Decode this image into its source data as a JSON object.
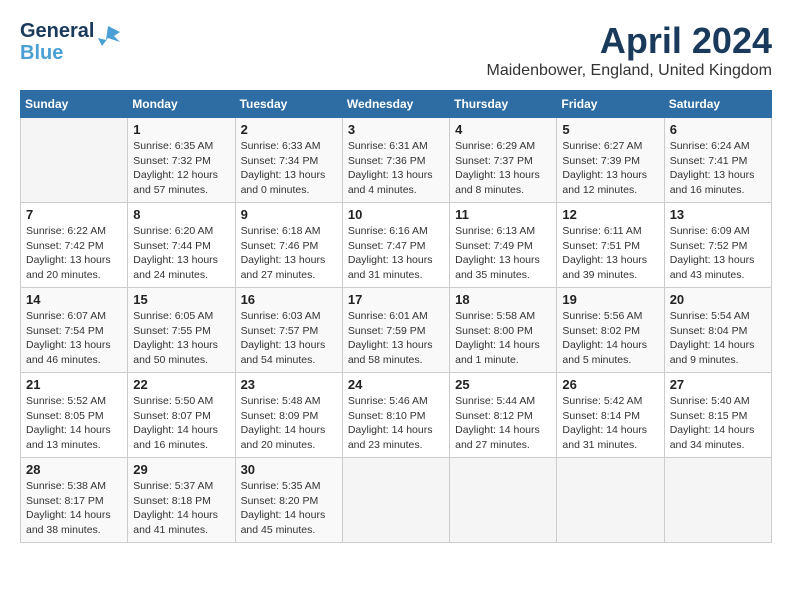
{
  "header": {
    "logo_general": "General",
    "logo_blue": "Blue",
    "month": "April 2024",
    "location": "Maidenbower, England, United Kingdom"
  },
  "weekdays": [
    "Sunday",
    "Monday",
    "Tuesday",
    "Wednesday",
    "Thursday",
    "Friday",
    "Saturday"
  ],
  "weeks": [
    [
      {
        "day": "",
        "info": ""
      },
      {
        "day": "1",
        "info": "Sunrise: 6:35 AM\nSunset: 7:32 PM\nDaylight: 12 hours\nand 57 minutes."
      },
      {
        "day": "2",
        "info": "Sunrise: 6:33 AM\nSunset: 7:34 PM\nDaylight: 13 hours\nand 0 minutes."
      },
      {
        "day": "3",
        "info": "Sunrise: 6:31 AM\nSunset: 7:36 PM\nDaylight: 13 hours\nand 4 minutes."
      },
      {
        "day": "4",
        "info": "Sunrise: 6:29 AM\nSunset: 7:37 PM\nDaylight: 13 hours\nand 8 minutes."
      },
      {
        "day": "5",
        "info": "Sunrise: 6:27 AM\nSunset: 7:39 PM\nDaylight: 13 hours\nand 12 minutes."
      },
      {
        "day": "6",
        "info": "Sunrise: 6:24 AM\nSunset: 7:41 PM\nDaylight: 13 hours\nand 16 minutes."
      }
    ],
    [
      {
        "day": "7",
        "info": "Sunrise: 6:22 AM\nSunset: 7:42 PM\nDaylight: 13 hours\nand 20 minutes."
      },
      {
        "day": "8",
        "info": "Sunrise: 6:20 AM\nSunset: 7:44 PM\nDaylight: 13 hours\nand 24 minutes."
      },
      {
        "day": "9",
        "info": "Sunrise: 6:18 AM\nSunset: 7:46 PM\nDaylight: 13 hours\nand 27 minutes."
      },
      {
        "day": "10",
        "info": "Sunrise: 6:16 AM\nSunset: 7:47 PM\nDaylight: 13 hours\nand 31 minutes."
      },
      {
        "day": "11",
        "info": "Sunrise: 6:13 AM\nSunset: 7:49 PM\nDaylight: 13 hours\nand 35 minutes."
      },
      {
        "day": "12",
        "info": "Sunrise: 6:11 AM\nSunset: 7:51 PM\nDaylight: 13 hours\nand 39 minutes."
      },
      {
        "day": "13",
        "info": "Sunrise: 6:09 AM\nSunset: 7:52 PM\nDaylight: 13 hours\nand 43 minutes."
      }
    ],
    [
      {
        "day": "14",
        "info": "Sunrise: 6:07 AM\nSunset: 7:54 PM\nDaylight: 13 hours\nand 46 minutes."
      },
      {
        "day": "15",
        "info": "Sunrise: 6:05 AM\nSunset: 7:55 PM\nDaylight: 13 hours\nand 50 minutes."
      },
      {
        "day": "16",
        "info": "Sunrise: 6:03 AM\nSunset: 7:57 PM\nDaylight: 13 hours\nand 54 minutes."
      },
      {
        "day": "17",
        "info": "Sunrise: 6:01 AM\nSunset: 7:59 PM\nDaylight: 13 hours\nand 58 minutes."
      },
      {
        "day": "18",
        "info": "Sunrise: 5:58 AM\nSunset: 8:00 PM\nDaylight: 14 hours\nand 1 minute."
      },
      {
        "day": "19",
        "info": "Sunrise: 5:56 AM\nSunset: 8:02 PM\nDaylight: 14 hours\nand 5 minutes."
      },
      {
        "day": "20",
        "info": "Sunrise: 5:54 AM\nSunset: 8:04 PM\nDaylight: 14 hours\nand 9 minutes."
      }
    ],
    [
      {
        "day": "21",
        "info": "Sunrise: 5:52 AM\nSunset: 8:05 PM\nDaylight: 14 hours\nand 13 minutes."
      },
      {
        "day": "22",
        "info": "Sunrise: 5:50 AM\nSunset: 8:07 PM\nDaylight: 14 hours\nand 16 minutes."
      },
      {
        "day": "23",
        "info": "Sunrise: 5:48 AM\nSunset: 8:09 PM\nDaylight: 14 hours\nand 20 minutes."
      },
      {
        "day": "24",
        "info": "Sunrise: 5:46 AM\nSunset: 8:10 PM\nDaylight: 14 hours\nand 23 minutes."
      },
      {
        "day": "25",
        "info": "Sunrise: 5:44 AM\nSunset: 8:12 PM\nDaylight: 14 hours\nand 27 minutes."
      },
      {
        "day": "26",
        "info": "Sunrise: 5:42 AM\nSunset: 8:14 PM\nDaylight: 14 hours\nand 31 minutes."
      },
      {
        "day": "27",
        "info": "Sunrise: 5:40 AM\nSunset: 8:15 PM\nDaylight: 14 hours\nand 34 minutes."
      }
    ],
    [
      {
        "day": "28",
        "info": "Sunrise: 5:38 AM\nSunset: 8:17 PM\nDaylight: 14 hours\nand 38 minutes."
      },
      {
        "day": "29",
        "info": "Sunrise: 5:37 AM\nSunset: 8:18 PM\nDaylight: 14 hours\nand 41 minutes."
      },
      {
        "day": "30",
        "info": "Sunrise: 5:35 AM\nSunset: 8:20 PM\nDaylight: 14 hours\nand 45 minutes."
      },
      {
        "day": "",
        "info": ""
      },
      {
        "day": "",
        "info": ""
      },
      {
        "day": "",
        "info": ""
      },
      {
        "day": "",
        "info": ""
      }
    ]
  ]
}
